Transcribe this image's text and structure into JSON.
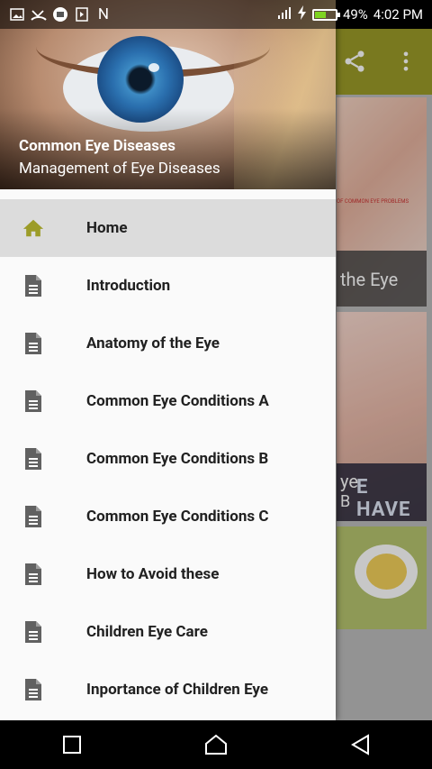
{
  "status_bar": {
    "battery": "49%",
    "time": "4:02 PM",
    "carrier_glyph": "N",
    "icons": [
      "image-icon",
      "missed-call-icon",
      "message-icon",
      "flipboard-icon",
      "n-icon",
      "signal-icon",
      "charging-icon",
      "battery-icon"
    ]
  },
  "drawer": {
    "header": {
      "title": "Common Eye Diseases",
      "subtitle": "Management of Eye Diseases"
    },
    "items": [
      {
        "label": "Home",
        "icon": "home-icon",
        "active": true
      },
      {
        "label": "Introduction",
        "icon": "document-icon"
      },
      {
        "label": "Anatomy of the Eye",
        "icon": "document-icon"
      },
      {
        "label": "Common Eye Conditions A",
        "icon": "document-icon"
      },
      {
        "label": "Common Eye Conditions B",
        "icon": "document-icon"
      },
      {
        "label": "Common Eye Conditions C",
        "icon": "document-icon"
      },
      {
        "label": "How to Avoid these",
        "icon": "document-icon"
      },
      {
        "label": "Children Eye Care",
        "icon": "document-icon"
      },
      {
        "label": "Inportance of Children Eye",
        "icon": "document-icon"
      }
    ]
  },
  "background": {
    "toolbar": {
      "icons": [
        "share-icon",
        "more-vert-icon"
      ]
    },
    "cards": [
      {
        "caption": "the Eye",
        "banner_text": "OF COMMON EYE PROBLEMS"
      },
      {
        "caption": "ye",
        "caption_line2": "B",
        "banner_text": "E HAVE"
      }
    ]
  },
  "colors": {
    "toolbar": "#9c9c28",
    "active_item_bg": "#dcdcdc",
    "home_icon": "#9c9c28",
    "document_icon": "#616161"
  },
  "navbar": {
    "buttons": [
      "recents-button",
      "home-button",
      "back-button"
    ]
  }
}
